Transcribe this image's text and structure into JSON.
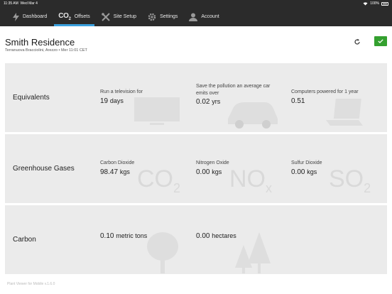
{
  "status_bar": {
    "time": "11:35 AM",
    "date": "Wed Mar 4",
    "battery": "100%"
  },
  "nav": {
    "tabs": [
      {
        "label": "Dashboard",
        "icon": "lightning-icon"
      },
      {
        "label": "Offsets",
        "badge": "CO2",
        "icon": "co2-icon",
        "active": true
      },
      {
        "label": "Site Setup",
        "icon": "tools-icon"
      },
      {
        "label": "Settings",
        "icon": "gear-icon"
      },
      {
        "label": "Account",
        "icon": "person-icon"
      }
    ],
    "active_color": "#3aa0dd"
  },
  "site": {
    "name": "Smith Residence",
    "location": "Terranuova Bracciolini, Arezzo • Mer 11:01 CET"
  },
  "confirm_color": "#34a02f",
  "rows": [
    {
      "label": "Equivalents",
      "cells": [
        {
          "label": "Run a television for",
          "value": "19",
          "unit": "days"
        },
        {
          "label": "Save the pollution an average car emits over",
          "value": "0.02",
          "unit": "yrs"
        },
        {
          "label": "Computers powered for 1 year",
          "value": "0.51",
          "unit": ""
        }
      ]
    },
    {
      "label": "Greenhouse Gases",
      "cells": [
        {
          "label": "Carbon Dioxide",
          "value": "98.47",
          "unit": "kgs",
          "bg": "CO",
          "bg_sub": "2"
        },
        {
          "label": "Nitrogen Oxide",
          "value": "0.00",
          "unit": "kgs",
          "bg": "NO",
          "bg_sub": "x"
        },
        {
          "label": "Sulfur Dioxide",
          "value": "0.00",
          "unit": "kgs",
          "bg": "SO",
          "bg_sub": "2"
        }
      ]
    },
    {
      "label": "Carbon",
      "cells": [
        {
          "label": "",
          "value": "0.10",
          "unit": "metric tons"
        },
        {
          "label": "",
          "value": "0.00",
          "unit": "hectares"
        }
      ]
    }
  ],
  "footer": "Plant Viewer for Mobile v.1.6.0"
}
